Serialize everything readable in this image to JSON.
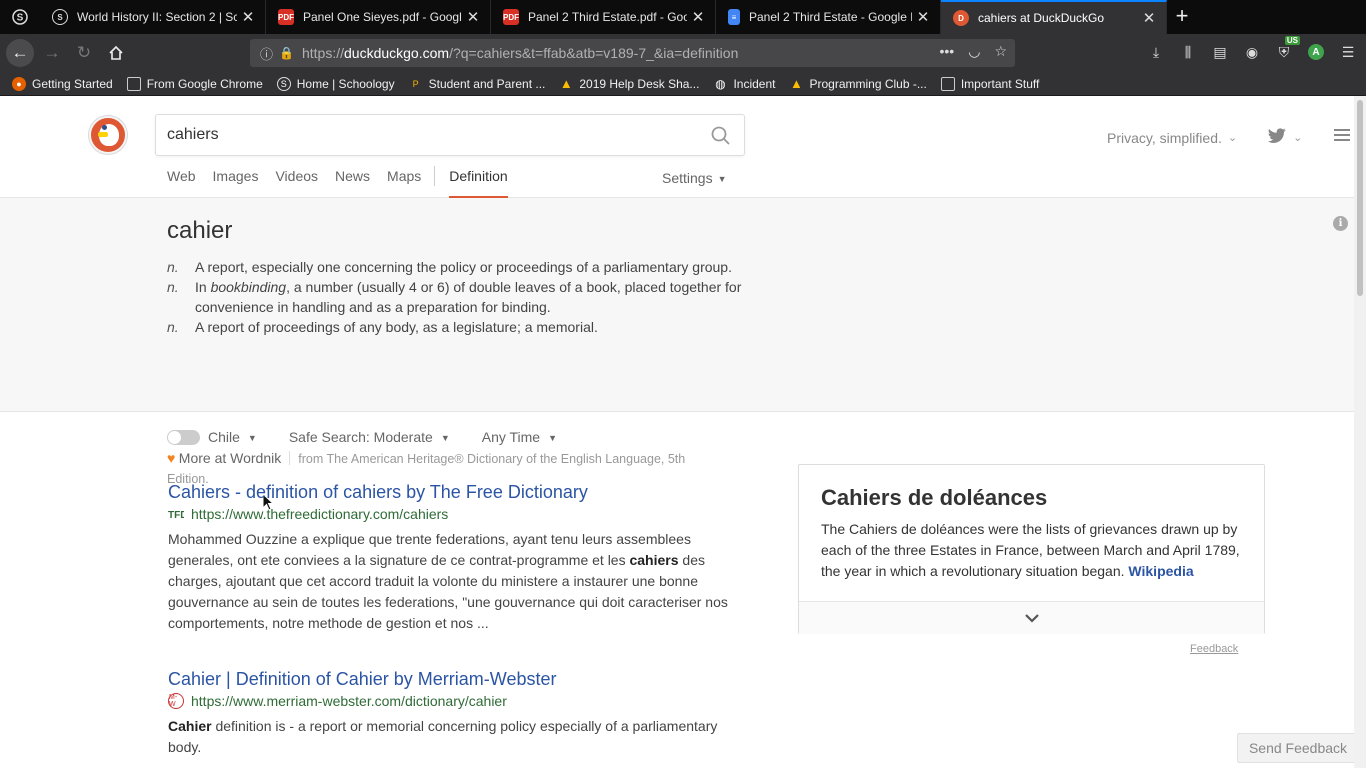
{
  "browser": {
    "tabs": [
      {
        "title": "World History II: Section 2 | Sch",
        "icon": "schoology-icon",
        "active": false
      },
      {
        "title": "Panel One Sieyes.pdf - Google",
        "icon": "pdf-icon",
        "active": false
      },
      {
        "title": "Panel 2 Third Estate.pdf - Goog",
        "icon": "pdf-icon",
        "active": false
      },
      {
        "title": "Panel 2 Third Estate - Google D",
        "icon": "docs-icon",
        "active": false
      },
      {
        "title": "cahiers at DuckDuckGo",
        "icon": "duckduckgo-icon",
        "active": true
      }
    ],
    "url": {
      "scheme": "https://",
      "host": "duckduckgo.com",
      "path": "/?q=cahiers&t=ffab&atb=v189-7_&ia=definition"
    },
    "bookmarks": [
      {
        "label": "Getting Started",
        "icon": "firefox-icon"
      },
      {
        "label": "From Google Chrome",
        "icon": "folder-icon"
      },
      {
        "label": "Home | Schoology",
        "icon": "schoology-icon"
      },
      {
        "label": "Student and Parent ...",
        "icon": "powerschool-icon"
      },
      {
        "label": "2019 Help Desk Sha...",
        "icon": "drive-icon"
      },
      {
        "label": "Incident",
        "icon": "globe-icon"
      },
      {
        "label": "Programming Club -...",
        "icon": "drive-icon"
      },
      {
        "label": "Important Stuff",
        "icon": "folder-icon"
      }
    ],
    "profile_initial": "A",
    "extension_badge": "US"
  },
  "header": {
    "search_value": "cahiers",
    "nav_tabs": [
      "Web",
      "Images",
      "Videos",
      "News",
      "Maps",
      "Definition"
    ],
    "active_tab": "Definition",
    "settings_label": "Settings",
    "privacy_label": "Privacy, simplified."
  },
  "definition": {
    "word": "cahier",
    "senses": [
      {
        "pos": "n.",
        "text_before": "A report, especially one concerning the policy or proceedings of a parliamentary group.",
        "em": "",
        "text_after": ""
      },
      {
        "pos": "n.",
        "text_before": "In ",
        "em": "bookbinding",
        "text_after": ", a number (usually 4 or 6) of double leaves of a book, placed together for convenience in handling and as a preparation for binding."
      },
      {
        "pos": "n.",
        "text_before": "A report of proceedings of any body, as a legislature; a memorial.",
        "em": "",
        "text_after": ""
      }
    ],
    "more_label": "More at Wordnik",
    "source": "from The American Heritage® Dictionary of the English Language, 5th Edition."
  },
  "filters": {
    "region": "Chile",
    "safe_search": "Safe Search: Moderate",
    "time": "Any Time"
  },
  "results": [
    {
      "title": "Cahiers - definition of cahiers by The Free Dictionary",
      "url": "https://www.thefreedictionary.com/cahiers",
      "snippet_before": "Mohammed Ouzzine a explique que trente federations, ayant tenu leurs assemblees generales, ont ete conviees a la signature de ce contrat-programme et les ",
      "snippet_bold": "cahiers",
      "snippet_after": " des charges, ajoutant que cet accord traduit la volonte du ministere a instaurer une bonne gouvernance au sein de toutes les federations, \"une gouvernance qui doit caracteriser nos comportements, notre methode de gestion et nos ..."
    },
    {
      "title": "Cahier | Definition of Cahier by Merriam-Webster",
      "url": "https://www.merriam-webster.com/dictionary/cahier",
      "snippet_before": "",
      "snippet_bold": "Cahier",
      "snippet_after": " definition is - a report or memorial concerning policy especially of a parliamentary body."
    }
  ],
  "knowledge_panel": {
    "title": "Cahiers de doléances",
    "text": "The Cahiers de doléances were the lists of grievances drawn up by each of the three Estates in France, between March and April 1789, the year in which a revolutionary situation began.",
    "link": "Wikipedia",
    "feedback": "Feedback"
  },
  "send_feedback": "Send Feedback",
  "colors": {
    "ddg_orange": "#de5833",
    "link_blue": "#2b54a4",
    "url_green": "#2e6b36",
    "chrome_dark": "#0c0c0d",
    "toolbar": "#323234"
  }
}
